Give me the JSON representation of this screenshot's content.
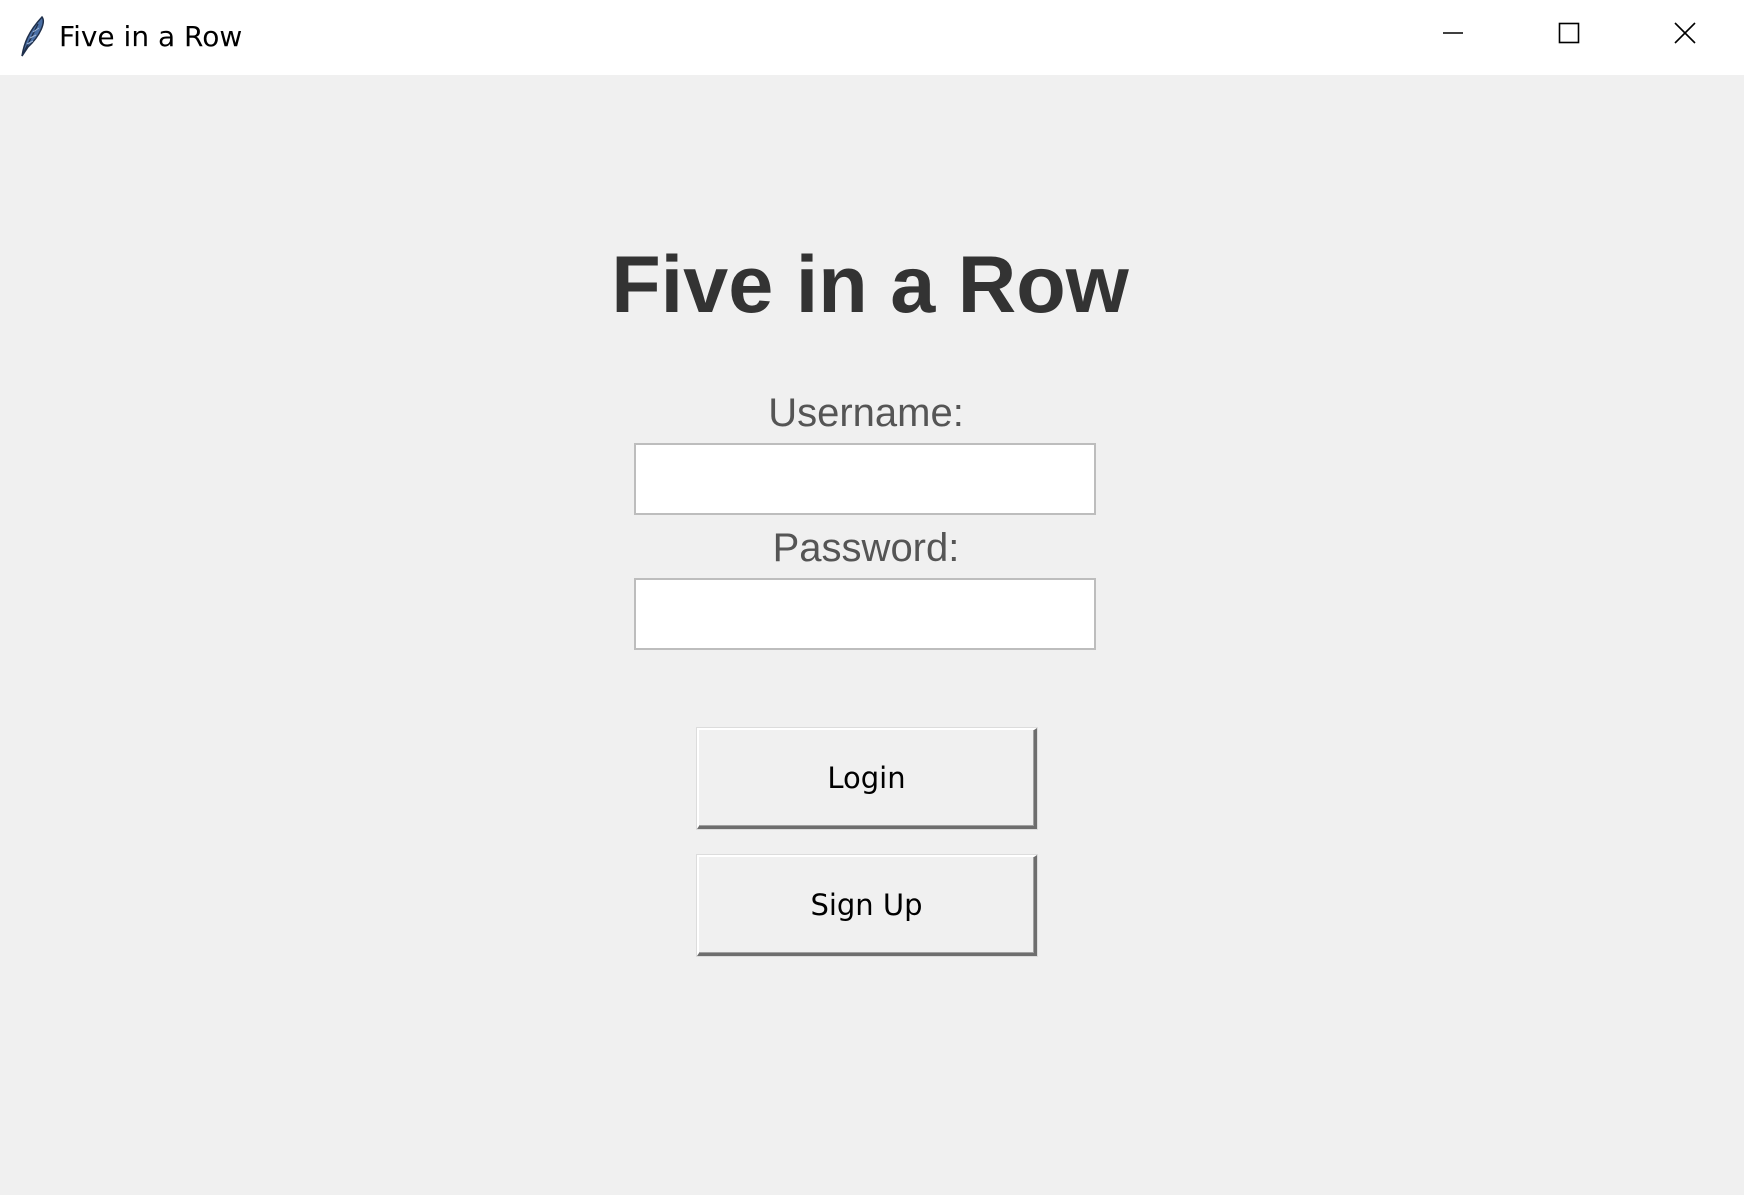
{
  "window": {
    "title": "Five in a Row",
    "icon": "feather-icon",
    "controls": {
      "minimize_icon": "minimize-icon",
      "maximize_icon": "maximize-icon",
      "close_icon": "close-icon"
    }
  },
  "login": {
    "title": "Five in a Row",
    "username_label": "Username:",
    "username_value": "",
    "password_label": "Password:",
    "password_value": "",
    "login_button": "Login",
    "signup_button": "Sign Up"
  },
  "colors": {
    "background": "#f0f0f0",
    "titlebar": "#ffffff",
    "title_text": "#333333",
    "label_text": "#555555"
  }
}
